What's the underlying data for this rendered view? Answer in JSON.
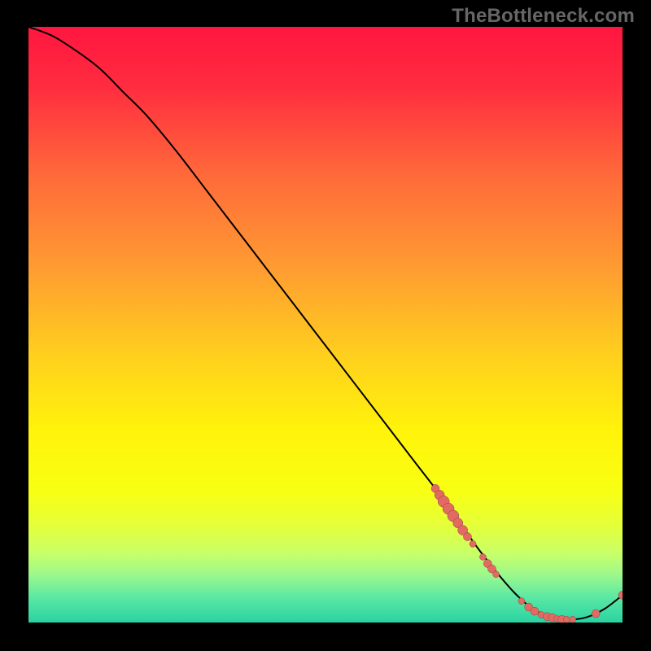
{
  "watermark": "TheBottleneck.com",
  "chart_data": {
    "type": "line",
    "title": "",
    "xlabel": "",
    "ylabel": "",
    "xlim": [
      0,
      100
    ],
    "ylim": [
      0,
      100
    ],
    "gradient": [
      {
        "offset": 0,
        "color": "#ff163f"
      },
      {
        "offset": 0.1,
        "color": "#ff2c3f"
      },
      {
        "offset": 0.25,
        "color": "#ff6a3a"
      },
      {
        "offset": 0.4,
        "color": "#ff9a32"
      },
      {
        "offset": 0.55,
        "color": "#ffcf1e"
      },
      {
        "offset": 0.68,
        "color": "#fff40a"
      },
      {
        "offset": 0.78,
        "color": "#f8ff13"
      },
      {
        "offset": 0.84,
        "color": "#e3ff3c"
      },
      {
        "offset": 0.885,
        "color": "#c7ff69"
      },
      {
        "offset": 0.92,
        "color": "#9cf88c"
      },
      {
        "offset": 0.955,
        "color": "#5fe9a3"
      },
      {
        "offset": 1.0,
        "color": "#29d3a3"
      }
    ],
    "series": [
      {
        "name": "bottleneck-curve",
        "stroke": "#000000",
        "x": [
          0,
          4,
          8,
          12,
          16,
          20,
          25,
          30,
          35,
          40,
          45,
          50,
          55,
          60,
          65,
          70,
          73,
          76,
          79,
          82,
          85,
          88,
          91,
          94,
          97,
          100
        ],
        "y": [
          100,
          98.5,
          96,
          93,
          89,
          85,
          79,
          72.5,
          66,
          59.5,
          53,
          46.5,
          40,
          33.5,
          27,
          20.5,
          16.2,
          12.0,
          8.2,
          4.8,
          2.2,
          0.9,
          0.5,
          0.9,
          2.3,
          4.6
        ]
      }
    ],
    "markers": {
      "color": "#e26a63",
      "stroke": "#90403c",
      "points": [
        {
          "x": 68.5,
          "y": 22.5,
          "r": 5
        },
        {
          "x": 69.2,
          "y": 21.4,
          "r": 6
        },
        {
          "x": 69.9,
          "y": 20.3,
          "r": 7
        },
        {
          "x": 70.7,
          "y": 19.1,
          "r": 7
        },
        {
          "x": 71.5,
          "y": 17.9,
          "r": 7
        },
        {
          "x": 72.3,
          "y": 16.7,
          "r": 6
        },
        {
          "x": 73.1,
          "y": 15.5,
          "r": 6
        },
        {
          "x": 73.9,
          "y": 14.4,
          "r": 5
        },
        {
          "x": 74.8,
          "y": 13.2,
          "r": 4
        },
        {
          "x": 76.5,
          "y": 11.0,
          "r": 4
        },
        {
          "x": 77.3,
          "y": 9.9,
          "r": 5
        },
        {
          "x": 78.0,
          "y": 9.0,
          "r": 5
        },
        {
          "x": 78.7,
          "y": 8.1,
          "r": 4
        },
        {
          "x": 83.0,
          "y": 3.6,
          "r": 4
        },
        {
          "x": 84.2,
          "y": 2.6,
          "r": 5
        },
        {
          "x": 85.2,
          "y": 1.9,
          "r": 5
        },
        {
          "x": 86.3,
          "y": 1.3,
          "r": 4
        },
        {
          "x": 87.3,
          "y": 1.0,
          "r": 5
        },
        {
          "x": 88.2,
          "y": 0.8,
          "r": 5
        },
        {
          "x": 89.0,
          "y": 0.6,
          "r": 4
        },
        {
          "x": 89.8,
          "y": 0.5,
          "r": 5
        },
        {
          "x": 90.6,
          "y": 0.5,
          "r": 4
        },
        {
          "x": 91.6,
          "y": 0.5,
          "r": 4
        },
        {
          "x": 95.5,
          "y": 1.5,
          "r": 5
        },
        {
          "x": 100.0,
          "y": 4.6,
          "r": 5
        }
      ]
    }
  }
}
